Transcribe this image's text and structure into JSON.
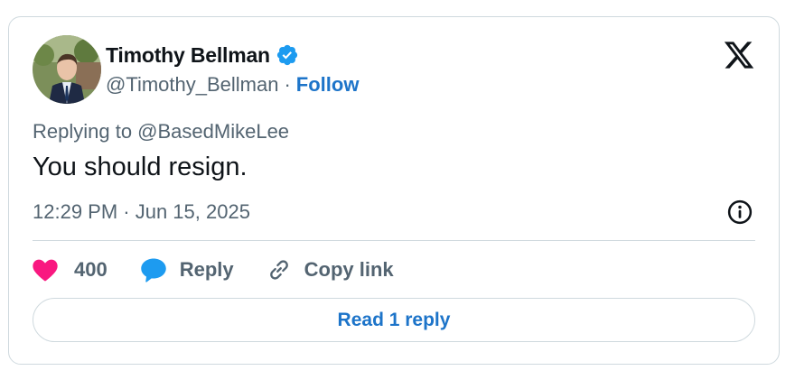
{
  "user": {
    "display_name": "Timothy Bellman",
    "handle": "@Timothy_Bellman",
    "separator": "·",
    "follow_label": "Follow",
    "verified": true
  },
  "tweet": {
    "reply_to": "Replying to @BasedMikeLee",
    "text": "You should resign.",
    "timestamp": "12:29 PM · Jun 15, 2025"
  },
  "actions": {
    "like_count": "400",
    "reply_label": "Reply",
    "copy_link_label": "Copy link"
  },
  "read_replies_label": "Read 1 reply",
  "icons": [
    "verified-badge-icon",
    "x-logo-icon",
    "info-icon",
    "heart-icon",
    "reply-bubble-icon",
    "link-icon"
  ],
  "colors": {
    "link_blue": "#1d74c9",
    "verified_blue": "#1d9bf0",
    "heart_pink": "#f91880",
    "secondary_text": "#536471",
    "border": "#cfd9de"
  }
}
